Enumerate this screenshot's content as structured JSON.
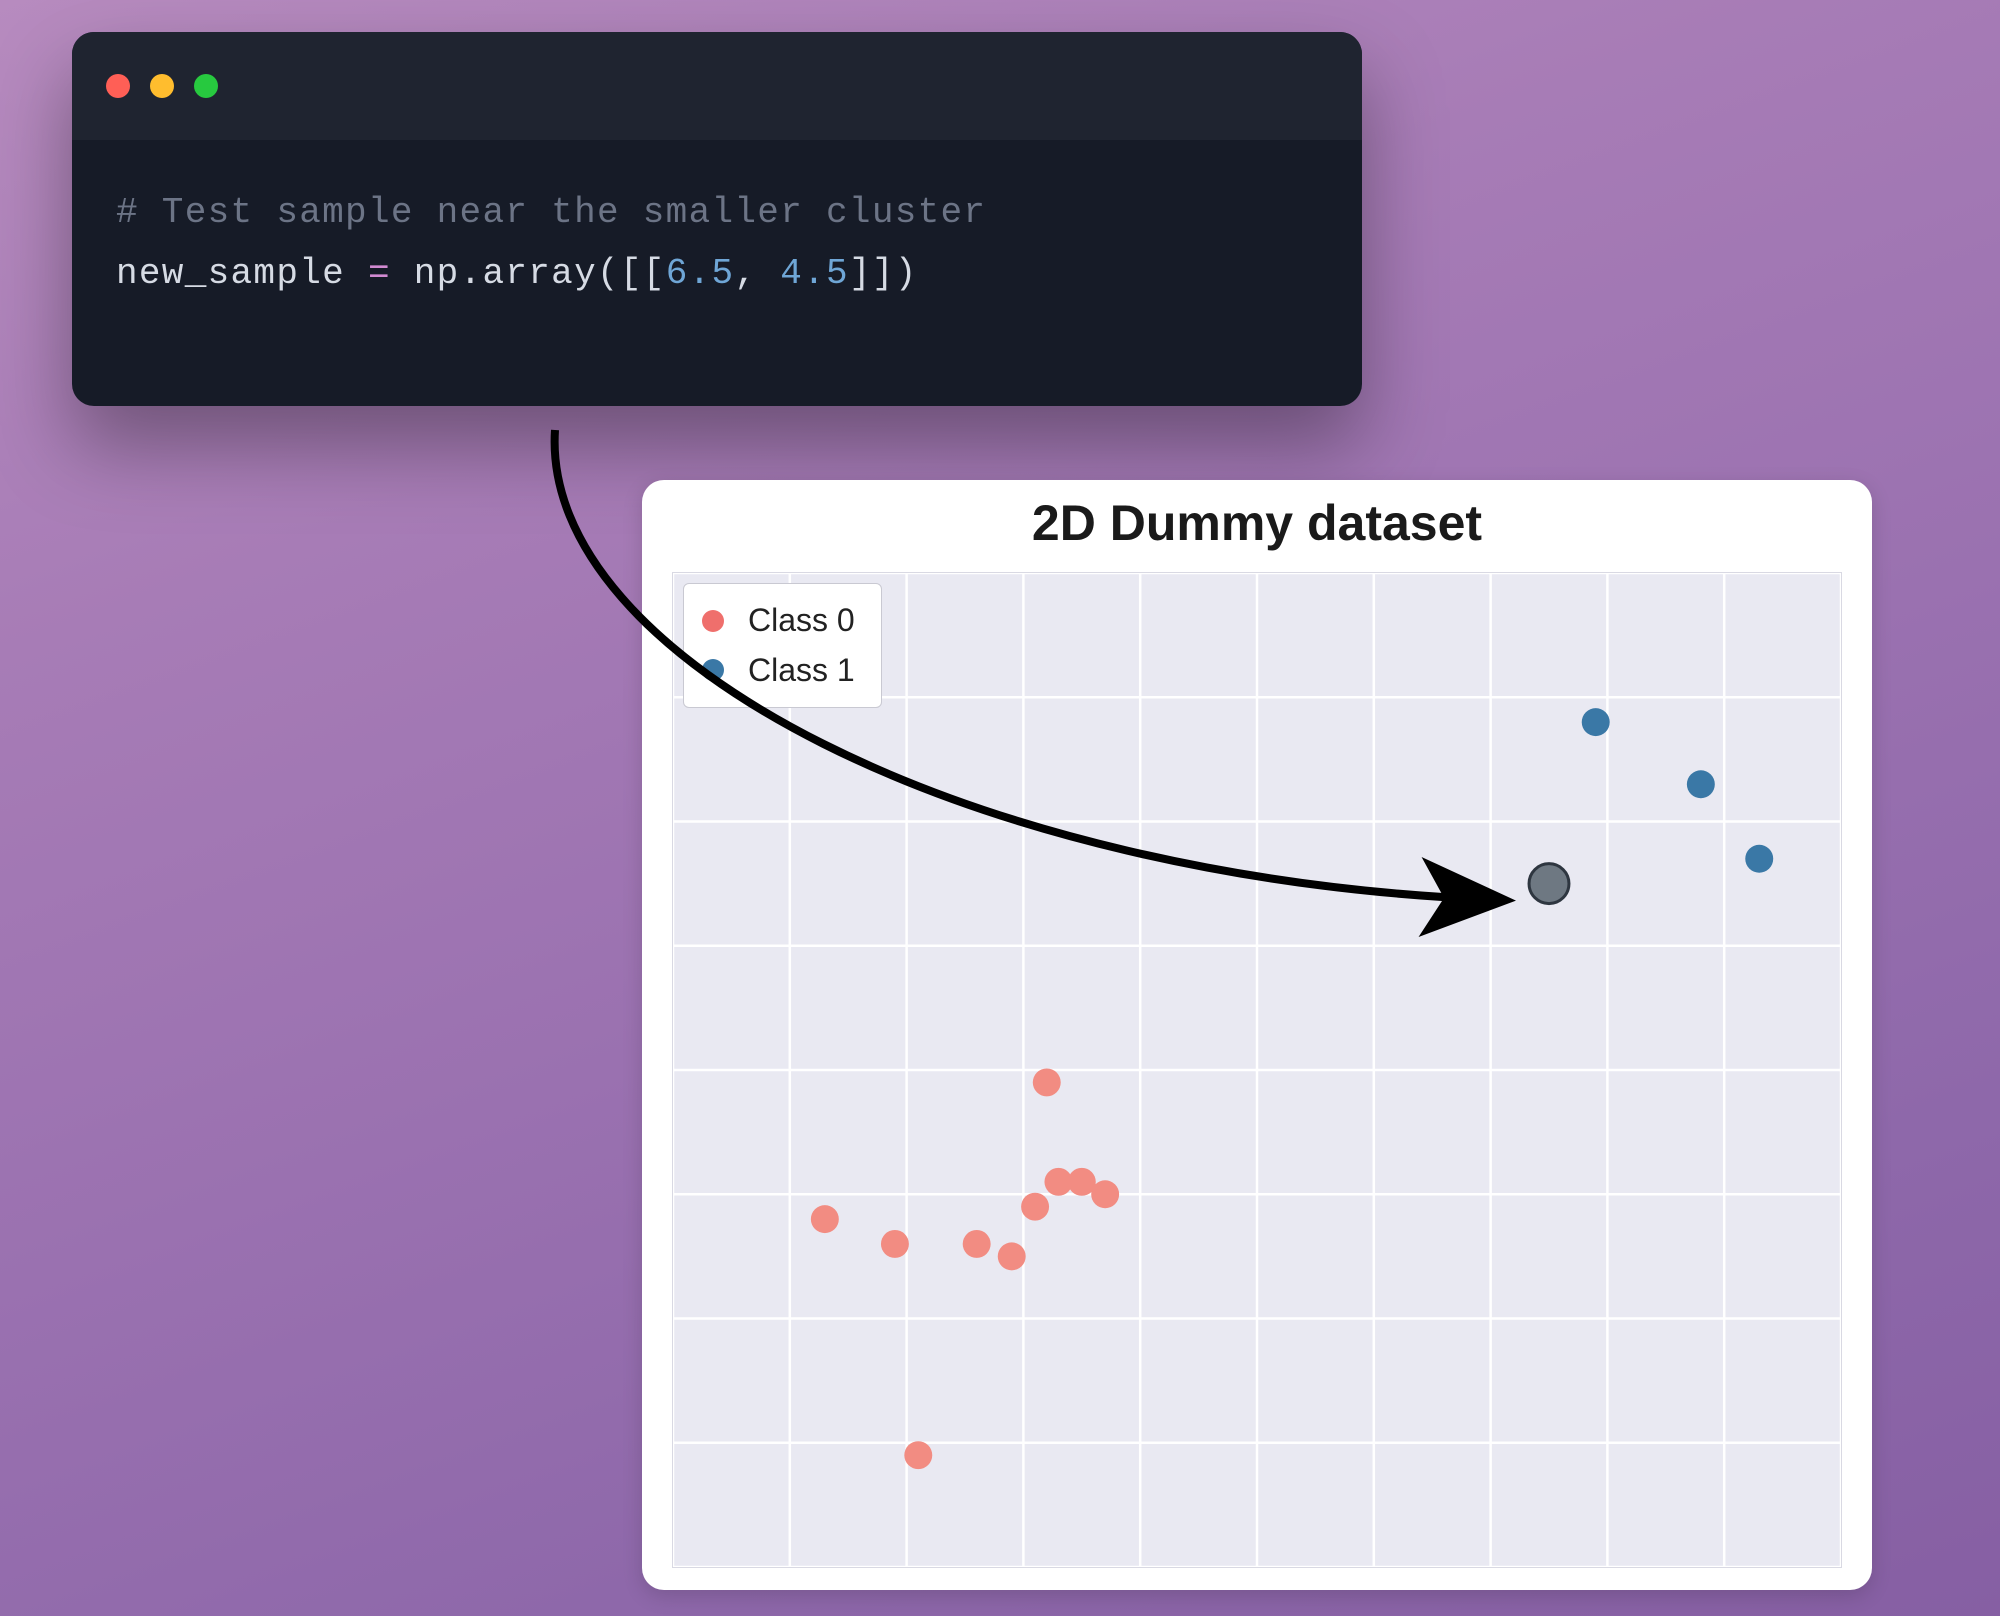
{
  "code": {
    "comment": "# Test sample near the smaller cluster",
    "var": "new_sample",
    "eq": "=",
    "call_prefix": "np.array([[",
    "num1": "6.5",
    "comma": ", ",
    "num2": "4.5",
    "call_suffix": "]])"
  },
  "chart": {
    "title": "2D Dummy dataset",
    "legend": {
      "class0": "Class 0",
      "class1": "Class 1"
    }
  },
  "chart_data": {
    "type": "scatter",
    "title": "2D Dummy dataset",
    "xlabel": "",
    "ylabel": "",
    "xlim": [
      -1,
      9
    ],
    "ylim": [
      -1,
      7
    ],
    "grid": true,
    "legend_position": "upper-left",
    "series": [
      {
        "name": "Class 0",
        "color": "#f28c82",
        "points": [
          {
            "x": 0.3,
            "y": 1.8
          },
          {
            "x": 0.9,
            "y": 1.6
          },
          {
            "x": 1.6,
            "y": 1.6
          },
          {
            "x": 1.9,
            "y": 1.5
          },
          {
            "x": 2.1,
            "y": 1.9
          },
          {
            "x": 2.3,
            "y": 2.1
          },
          {
            "x": 2.5,
            "y": 2.1
          },
          {
            "x": 2.7,
            "y": 2.0
          },
          {
            "x": 2.2,
            "y": 2.9
          },
          {
            "x": 1.1,
            "y": -0.1
          }
        ]
      },
      {
        "name": "Class 1",
        "color": "#3a78a6",
        "points": [
          {
            "x": 6.9,
            "y": 5.8
          },
          {
            "x": 7.8,
            "y": 5.3
          },
          {
            "x": 8.3,
            "y": 4.7
          }
        ]
      },
      {
        "name": "new_sample",
        "color": "#6e7882",
        "points": [
          {
            "x": 6.5,
            "y": 4.5
          }
        ]
      }
    ]
  }
}
